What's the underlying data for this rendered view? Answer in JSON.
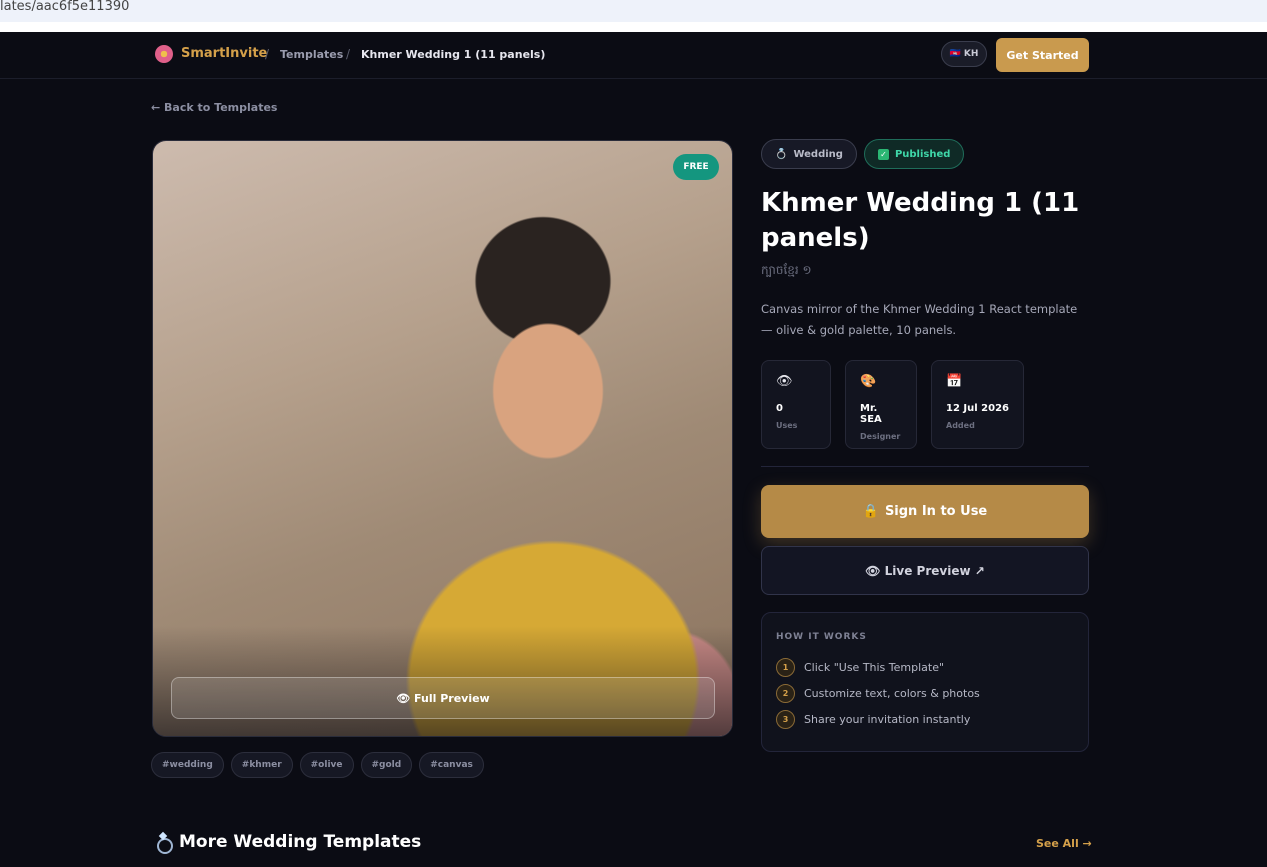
{
  "browser": {
    "url_text": "lates/aac6f5e11390"
  },
  "nav": {
    "brand": "SmartInvite",
    "breadcrumbs": [
      "Templates",
      "Khmer Wedding 1 (11 panels)"
    ],
    "separator": "/",
    "lang_label": "🇰🇭 KH",
    "cta": "Get Started"
  },
  "back_link": "← Back to Templates",
  "hero": {
    "badge": "FREE",
    "full_preview_label": "👁 Full Preview"
  },
  "tags": [
    "#wedding",
    "#khmer",
    "#olive",
    "#gold",
    "#canvas"
  ],
  "template": {
    "category_icon": "💍",
    "category": "Wedding",
    "status_icon": "✓",
    "status": "Published",
    "title": "Khmer Wedding 1 (11 panels)",
    "subtitle": "ក្បាចខ្មែរ ១",
    "description": "Canvas mirror of the Khmer Wedding 1 React template — olive & gold palette, 10 panels."
  },
  "stats": [
    {
      "icon": "👁",
      "value": "0",
      "label": "Uses"
    },
    {
      "icon": "🎨",
      "value": "Mr. SEA",
      "label": "Designer"
    },
    {
      "icon": "📅",
      "value": "12 Jul 2026",
      "label": "Added"
    }
  ],
  "actions": {
    "sign_in_icon": "🔒",
    "sign_in": "Sign In to Use",
    "live_preview": "👁 Live Preview ↗"
  },
  "how_it_works": {
    "title": "HOW IT WORKS",
    "steps": [
      {
        "num": "1",
        "text": "Click \"Use This Template\""
      },
      {
        "num": "2",
        "text": "Customize text, colors & photos"
      },
      {
        "num": "3",
        "text": "Share your invitation instantly"
      }
    ]
  },
  "more": {
    "title": "More Wedding Templates",
    "see_all": "See All →"
  },
  "colors": {
    "accent": "#c99a4e",
    "background": "#0b0c14",
    "success": "#3fd6a8",
    "free_badge": "#14967f"
  }
}
